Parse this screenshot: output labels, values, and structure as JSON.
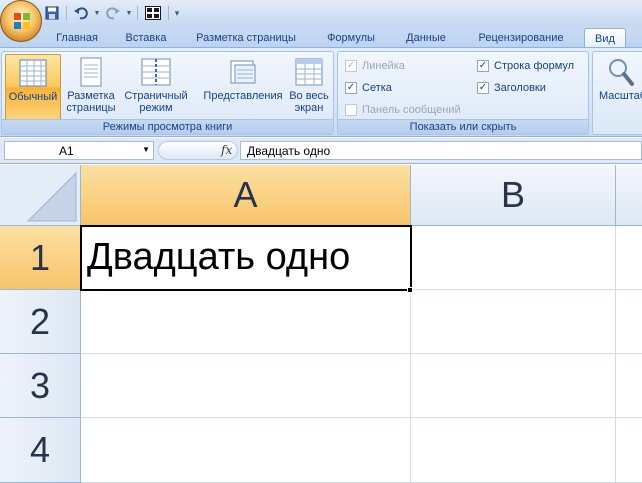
{
  "quick_access": {
    "icons": [
      "save-icon",
      "undo-icon",
      "redo-icon",
      "table-icon"
    ]
  },
  "tabs": [
    {
      "label": "Главная",
      "active": false
    },
    {
      "label": "Вставка",
      "active": false
    },
    {
      "label": "Разметка страницы",
      "active": false
    },
    {
      "label": "Формулы",
      "active": false
    },
    {
      "label": "Данные",
      "active": false
    },
    {
      "label": "Рецензирование",
      "active": false
    },
    {
      "label": "Вид",
      "active": true
    }
  ],
  "ribbon": {
    "view_modes": {
      "label": "Режимы просмотра книги",
      "buttons": [
        {
          "label": "Обычный",
          "pressed": true
        },
        {
          "label": "Разметка страницы",
          "pressed": false
        },
        {
          "label": "Страничный режим",
          "pressed": false
        },
        {
          "label": "Представления",
          "pressed": false
        },
        {
          "label": "Во весь экран",
          "pressed": false
        }
      ]
    },
    "show_hide": {
      "label": "Показать или скрыть",
      "checkboxes": [
        {
          "label": "Линейка",
          "checked": true,
          "disabled": true
        },
        {
          "label": "Сетка",
          "checked": true,
          "disabled": false
        },
        {
          "label": "Панель сообщений",
          "checked": false,
          "disabled": true
        },
        {
          "label": "Строка формул",
          "checked": true,
          "disabled": false
        },
        {
          "label": "Заголовки",
          "checked": true,
          "disabled": false
        }
      ]
    },
    "zoom": {
      "button_label": "Масштаб"
    }
  },
  "formula_bar": {
    "name_box": "A1",
    "fx_label": "fx",
    "content": "Двадцать одно"
  },
  "grid": {
    "columns": [
      "A",
      "B"
    ],
    "rows": [
      "1",
      "2",
      "3",
      "4"
    ],
    "selected_cell": "A1",
    "cells": {
      "A1": "Двадцать одно"
    }
  },
  "colors": {
    "selection_header": "#f8c46a",
    "ribbon_text": "#15428b",
    "header_bg": "#dde7f4"
  }
}
